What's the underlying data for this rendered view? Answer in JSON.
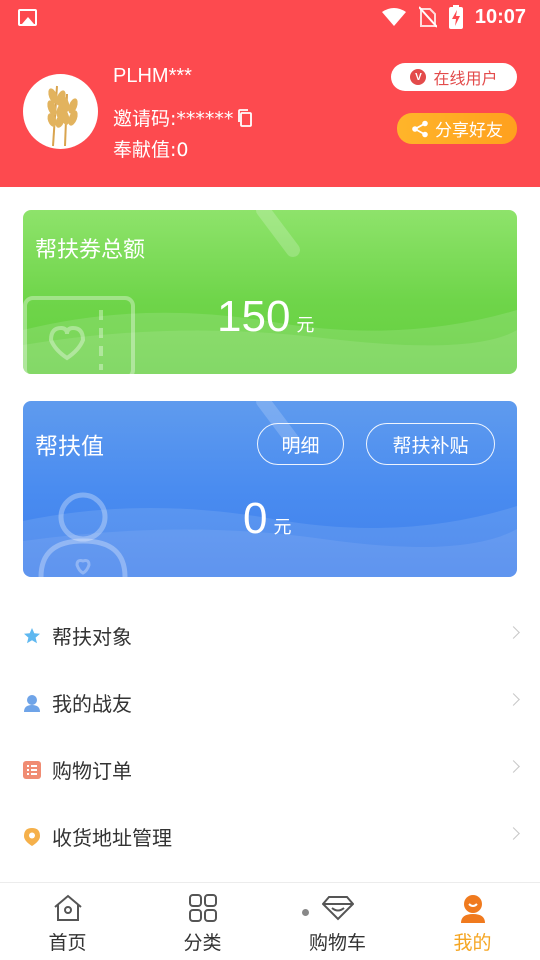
{
  "status_bar": {
    "time": "10:07"
  },
  "profile": {
    "username": "PLHM***",
    "invite_label": "邀请码:******",
    "contribution_label": "奉献值:0",
    "online_button": "在线用户",
    "online_badge": "V",
    "share_button": "分享好友"
  },
  "coupon_card": {
    "title": "帮扶券总额",
    "amount": "150",
    "unit": "元"
  },
  "value_card": {
    "title": "帮扶值",
    "amount": "0",
    "unit": "元",
    "detail_button": "明细",
    "subsidy_button": "帮扶补贴"
  },
  "menu": {
    "items": [
      {
        "label": "帮扶对象",
        "icon": "star-icon"
      },
      {
        "label": "我的战友",
        "icon": "person-icon"
      },
      {
        "label": "购物订单",
        "icon": "list-icon"
      },
      {
        "label": "收货地址管理",
        "icon": "location-icon"
      }
    ]
  },
  "tabbar": {
    "tabs": [
      {
        "label": "首页",
        "icon": "home-icon"
      },
      {
        "label": "分类",
        "icon": "grid-icon"
      },
      {
        "label": "购物车",
        "icon": "diamond-icon"
      },
      {
        "label": "我的",
        "icon": "profile-icon"
      }
    ],
    "active": "我的"
  },
  "colors": {
    "header_red": "#fd4a4f",
    "green_card": "#6fd54a",
    "blue_card": "#4a8cf0",
    "accent_orange": "#f5a623"
  }
}
